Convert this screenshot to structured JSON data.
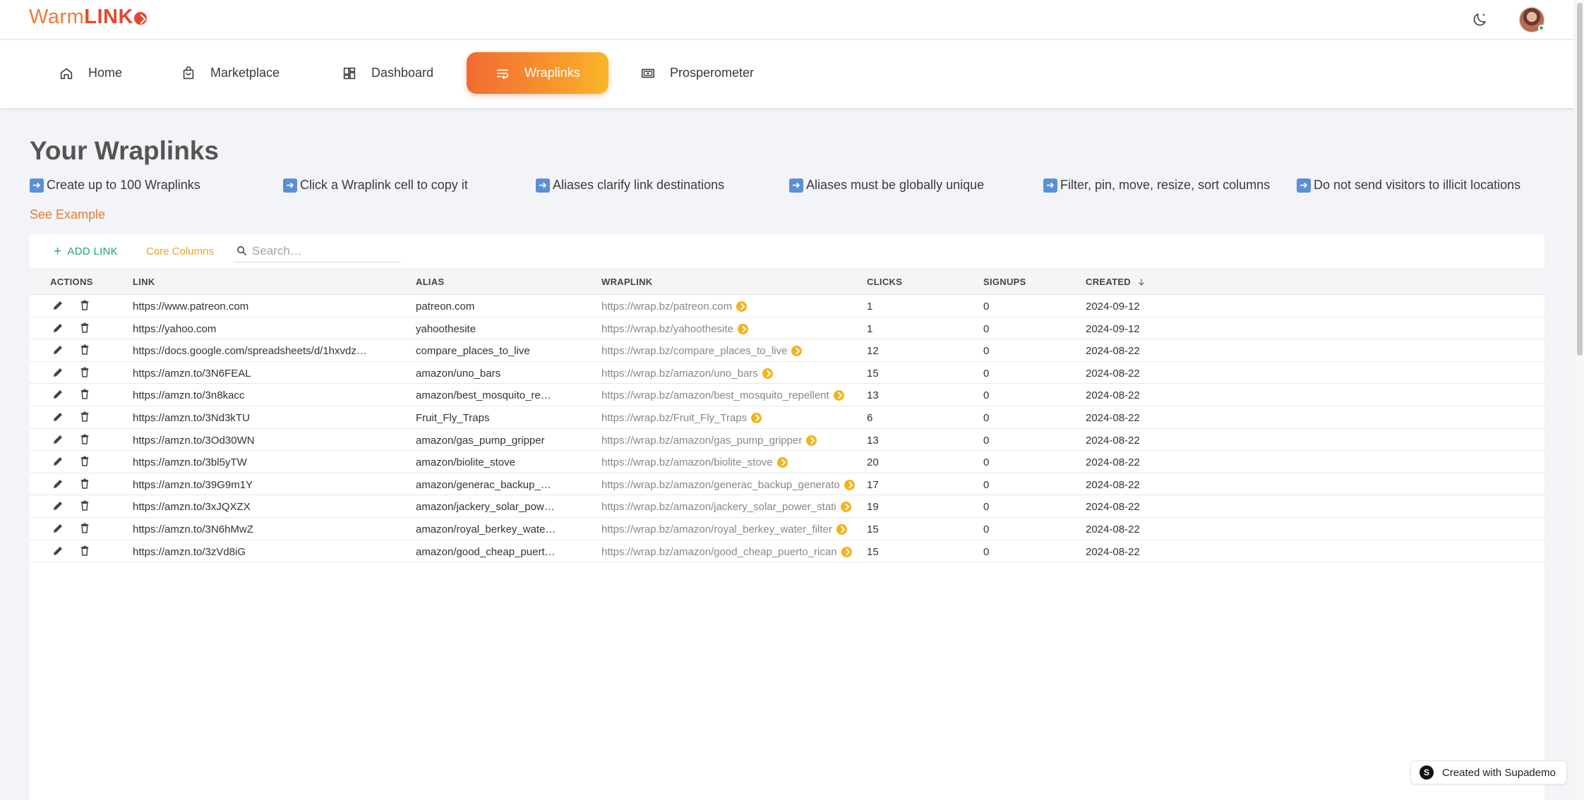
{
  "brand": {
    "warm": "Warm",
    "link": "LINK",
    "accent": "#f07a3a"
  },
  "nav": {
    "items": [
      {
        "label": "Home",
        "icon": "home-icon"
      },
      {
        "label": "Marketplace",
        "icon": "bag-icon"
      },
      {
        "label": "Dashboard",
        "icon": "dashboard-icon"
      },
      {
        "label": "Wraplinks",
        "icon": "wraplink-icon",
        "active": true
      },
      {
        "label": "Prosperometer",
        "icon": "meter-icon"
      }
    ]
  },
  "page": {
    "title": "Your Wraplinks",
    "tips": [
      "Create up to 100 Wraplinks",
      "Click a Wraplink cell to copy it",
      "Aliases clarify link destinations",
      "Aliases must be globally unique",
      "Filter, pin, move, resize, sort columns",
      "Do not send visitors to illicit locations"
    ],
    "see_example": "See Example"
  },
  "toolbar": {
    "add_link": "ADD LINK",
    "core_columns": "Core Columns",
    "search_placeholder": "Search…"
  },
  "table": {
    "columns": [
      "ACTIONS",
      "LINK",
      "ALIAS",
      "WRAPLINK",
      "CLICKS",
      "SIGNUPS",
      "CREATED"
    ],
    "rows": [
      {
        "link": "https://www.patreon.com",
        "alias": "patreon.com",
        "wraplink": "https://wrap.bz/patreon.com",
        "clicks": "1",
        "signups": "0",
        "created": "2024-09-12"
      },
      {
        "link": "https://yahoo.com",
        "alias": "yahoothesite",
        "wraplink": "https://wrap.bz/yahoothesite",
        "clicks": "1",
        "signups": "0",
        "created": "2024-09-12"
      },
      {
        "link": "https://docs.google.com/spreadsheets/d/1hxvdz…",
        "alias": "compare_places_to_live",
        "wraplink": "https://wrap.bz/compare_places_to_live",
        "clicks": "12",
        "signups": "0",
        "created": "2024-08-22"
      },
      {
        "link": "https://amzn.to/3N6FEAL",
        "alias": "amazon/uno_bars",
        "wraplink": "https://wrap.bz/amazon/uno_bars",
        "clicks": "15",
        "signups": "0",
        "created": "2024-08-22"
      },
      {
        "link": "https://amzn.to/3n8kacc",
        "alias": "amazon/best_mosquito_re…",
        "wraplink": "https://wrap.bz/amazon/best_mosquito_repellent",
        "clicks": "13",
        "signups": "0",
        "created": "2024-08-22"
      },
      {
        "link": "https://amzn.to/3Nd3kTU",
        "alias": "Fruit_Fly_Traps",
        "wraplink": "https://wrap.bz/Fruit_Fly_Traps",
        "clicks": "6",
        "signups": "0",
        "created": "2024-08-22"
      },
      {
        "link": "https://amzn.to/3Od30WN",
        "alias": "amazon/gas_pump_gripper",
        "wraplink": "https://wrap.bz/amazon/gas_pump_gripper",
        "clicks": "13",
        "signups": "0",
        "created": "2024-08-22"
      },
      {
        "link": "https://amzn.to/3bl5yTW",
        "alias": "amazon/biolite_stove",
        "wraplink": "https://wrap.bz/amazon/biolite_stove",
        "clicks": "20",
        "signups": "0",
        "created": "2024-08-22"
      },
      {
        "link": "https://amzn.to/39G9m1Y",
        "alias": "amazon/generac_backup_…",
        "wraplink": "https://wrap.bz/amazon/generac_backup_generato",
        "clicks": "17",
        "signups": "0",
        "created": "2024-08-22"
      },
      {
        "link": "https://amzn.to/3xJQXZX",
        "alias": "amazon/jackery_solar_pow…",
        "wraplink": "https://wrap.bz/amazon/jackery_solar_power_stati",
        "clicks": "19",
        "signups": "0",
        "created": "2024-08-22"
      },
      {
        "link": "https://amzn.to/3N6hMwZ",
        "alias": "amazon/royal_berkey_wate…",
        "wraplink": "https://wrap.bz/amazon/royal_berkey_water_filter",
        "clicks": "15",
        "signups": "0",
        "created": "2024-08-22"
      },
      {
        "link": "https://amzn.to/3zVd8iG",
        "alias": "amazon/good_cheap_puert…",
        "wraplink": "https://wrap.bz/amazon/good_cheap_puerto_rican",
        "clicks": "15",
        "signups": "0",
        "created": "2024-08-22"
      }
    ]
  },
  "badge": {
    "label": "Created with Supademo",
    "letter": "S"
  }
}
